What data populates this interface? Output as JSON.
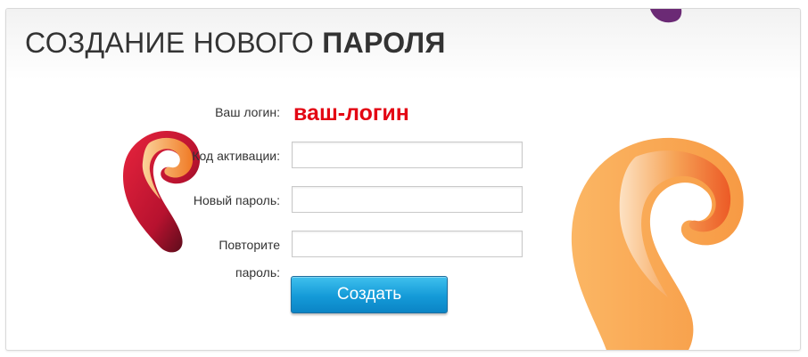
{
  "header": {
    "title_regular": "СОЗДАНИЕ НОВОГО",
    "title_bold": "ПАРОЛЯ"
  },
  "form": {
    "login_label": "Ваш логин:",
    "login_value": "ваш-логин",
    "activation_label": "Код активации:",
    "activation_value": "",
    "new_password_label": "Новый пароль:",
    "new_password_value": "",
    "repeat_password_label_line1": "Повторите",
    "repeat_password_label_line2": "пароль:",
    "repeat_password_value": "",
    "submit_label": "Создать"
  },
  "icons": {
    "brand_logo": "rostelecom-logo-icon"
  },
  "colors": {
    "login_value": "#e30613",
    "button": "#149ad8",
    "logo_orange": "#f7a44a",
    "logo_red": "#d4143a",
    "logo_purple": "#7b2d7e"
  }
}
